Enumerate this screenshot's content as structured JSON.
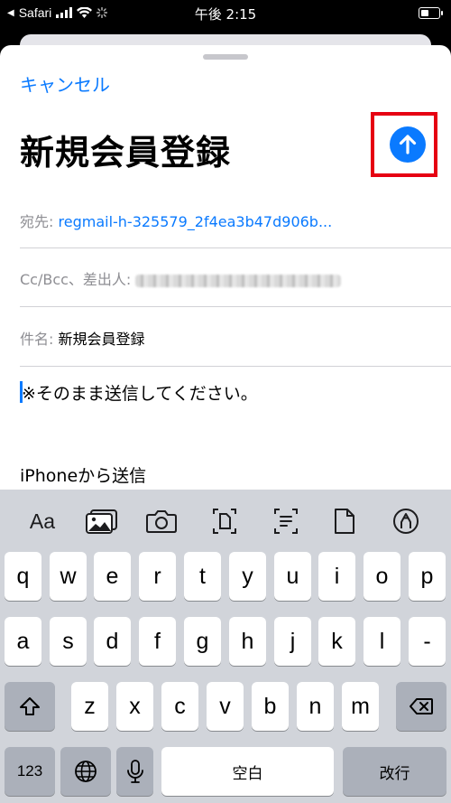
{
  "status_bar": {
    "carrier": "Safari",
    "time": "午後 2:15"
  },
  "compose": {
    "cancel_label": "キャンセル",
    "title": "新規会員登録",
    "to_label": "宛先:",
    "to_value": "regmail-h-325579_2f4ea3b47d906b...",
    "cc_label": "Cc/Bcc、差出人:",
    "subject_label": "件名:",
    "subject_value": "新規会員登録",
    "body": "※そのまま送信してください。",
    "signature": "iPhoneから送信",
    "accent_color": "#0a7aff",
    "highlight_color": "#e60012"
  },
  "toolbar": {
    "format_label": "Aa"
  },
  "keyboard": {
    "row1": [
      "q",
      "w",
      "e",
      "r",
      "t",
      "y",
      "u",
      "i",
      "o",
      "p"
    ],
    "row2": [
      "a",
      "s",
      "d",
      "f",
      "g",
      "h",
      "j",
      "k",
      "l",
      "-"
    ],
    "row3": [
      "z",
      "x",
      "c",
      "v",
      "b",
      "n",
      "m"
    ],
    "numbers_label": "123",
    "space_label": "空白",
    "return_label": "改行"
  }
}
